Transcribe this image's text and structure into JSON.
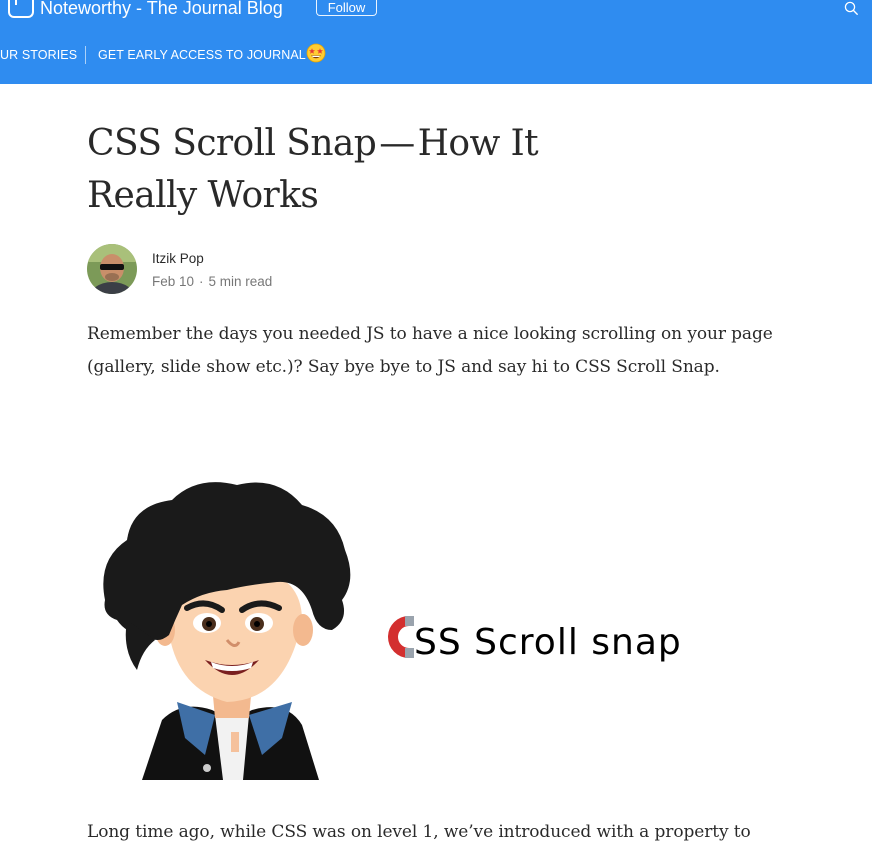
{
  "header": {
    "publication_title": "Noteworthy - The Journal Blog",
    "follow_label": "Follow",
    "nav": [
      {
        "label": "UR STORIES"
      },
      {
        "label": "GET EARLY ACCESS TO JOURNAL"
      }
    ],
    "nav_emoji_icon": "star-struck-emoji-icon",
    "search_icon": "search-icon",
    "colors": {
      "bar": "#2f8cf0",
      "text": "#ffffff"
    }
  },
  "article": {
    "title": "CSS Scroll Snap — How It Really Works",
    "author": {
      "name": "Itzik Pop",
      "date": "Feb 10",
      "separator": "·",
      "read_time": "5 min read"
    },
    "intro": "Remember the days you needed JS to have a nice looking scrolling on your page (gallery, slide show etc.)? Say bye bye to JS and say hi to CSS Scroll Snap.",
    "hero": {
      "illustration": "cartoon-author-avatar",
      "magnet_icon": "magnet-icon",
      "text": "SS Scroll snap"
    },
    "body_start": "Long time ago, while CSS was on level 1, we’ve introduced with a property to"
  }
}
